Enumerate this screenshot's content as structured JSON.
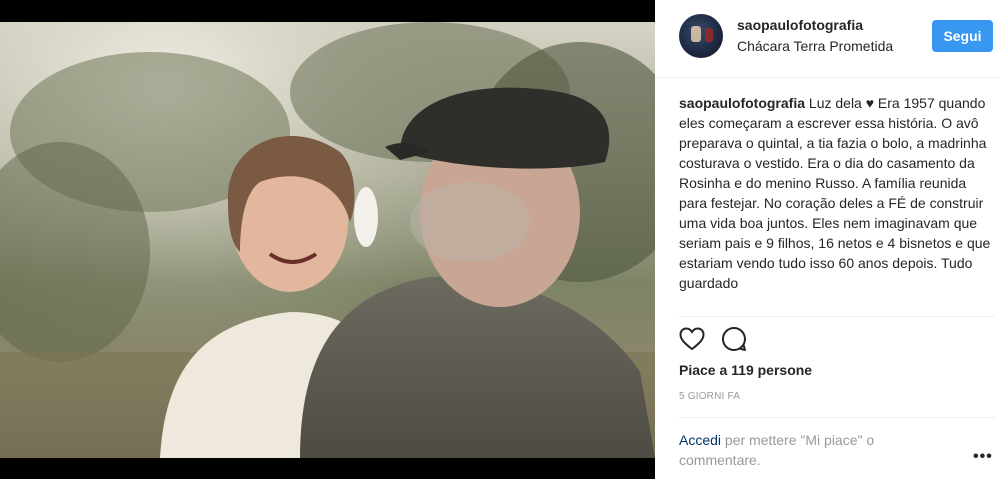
{
  "post": {
    "username": "saopaulofotografia",
    "location": "Chácara Terra Prometida",
    "follow_label": "Segui",
    "caption_user": "saopaulofotografia",
    "caption_text": "Luz dela ♥ Era 1957 quando eles começaram a escrever essa história. O avô preparava o quintal, a tia fazia o bolo, a madrinha costurava o vestido. Era o dia do casamento da Rosinha e do menino Russo. A família reunida para festejar. No coração deles a FÉ de construir uma vida boa juntos. Eles nem imaginavam que seriam pais e 9 filhos, 16 netos e 4 bisnetos e que estariam vendo tudo isso 60 anos depois. Tudo guardado",
    "likes_text": "Piace a 119 persone",
    "timestamp": "5 GIORNI FA",
    "login_link": "Accedi",
    "login_rest": " per mettere \"Mi piace\" o commentare.",
    "more_label": "•••"
  },
  "icons": {
    "like": "heart-icon",
    "comment": "comment-icon",
    "more": "more-options-icon"
  },
  "colors": {
    "accent": "#3897f0",
    "link": "#003569",
    "muted": "#999999",
    "text": "#262626"
  }
}
